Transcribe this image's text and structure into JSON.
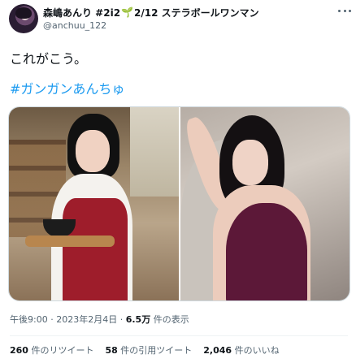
{
  "header": {
    "display_name": "森嶋あんり #2i2",
    "sprout": "🌱",
    "name_suffix": "2/12 ステラボールワンマン",
    "handle": "@anchuu_122"
  },
  "tweet": {
    "text": "これがこう。",
    "hashtag": "#ガンガンあんちゅ"
  },
  "meta": {
    "time": "午後9:00",
    "separator": " · ",
    "date": "2023年2月4日",
    "views_count": "6.5万",
    "views_label": " 件の表示"
  },
  "stats": {
    "retweets_count": "260",
    "retweets_label": " 件のリツイート",
    "quotes_count": "58",
    "quotes_label": " 件の引用ツイート",
    "likes_count": "2,046",
    "likes_label": " 件のいいね"
  },
  "icons": {
    "avatar": "avatar-image",
    "more": "more-icon"
  }
}
